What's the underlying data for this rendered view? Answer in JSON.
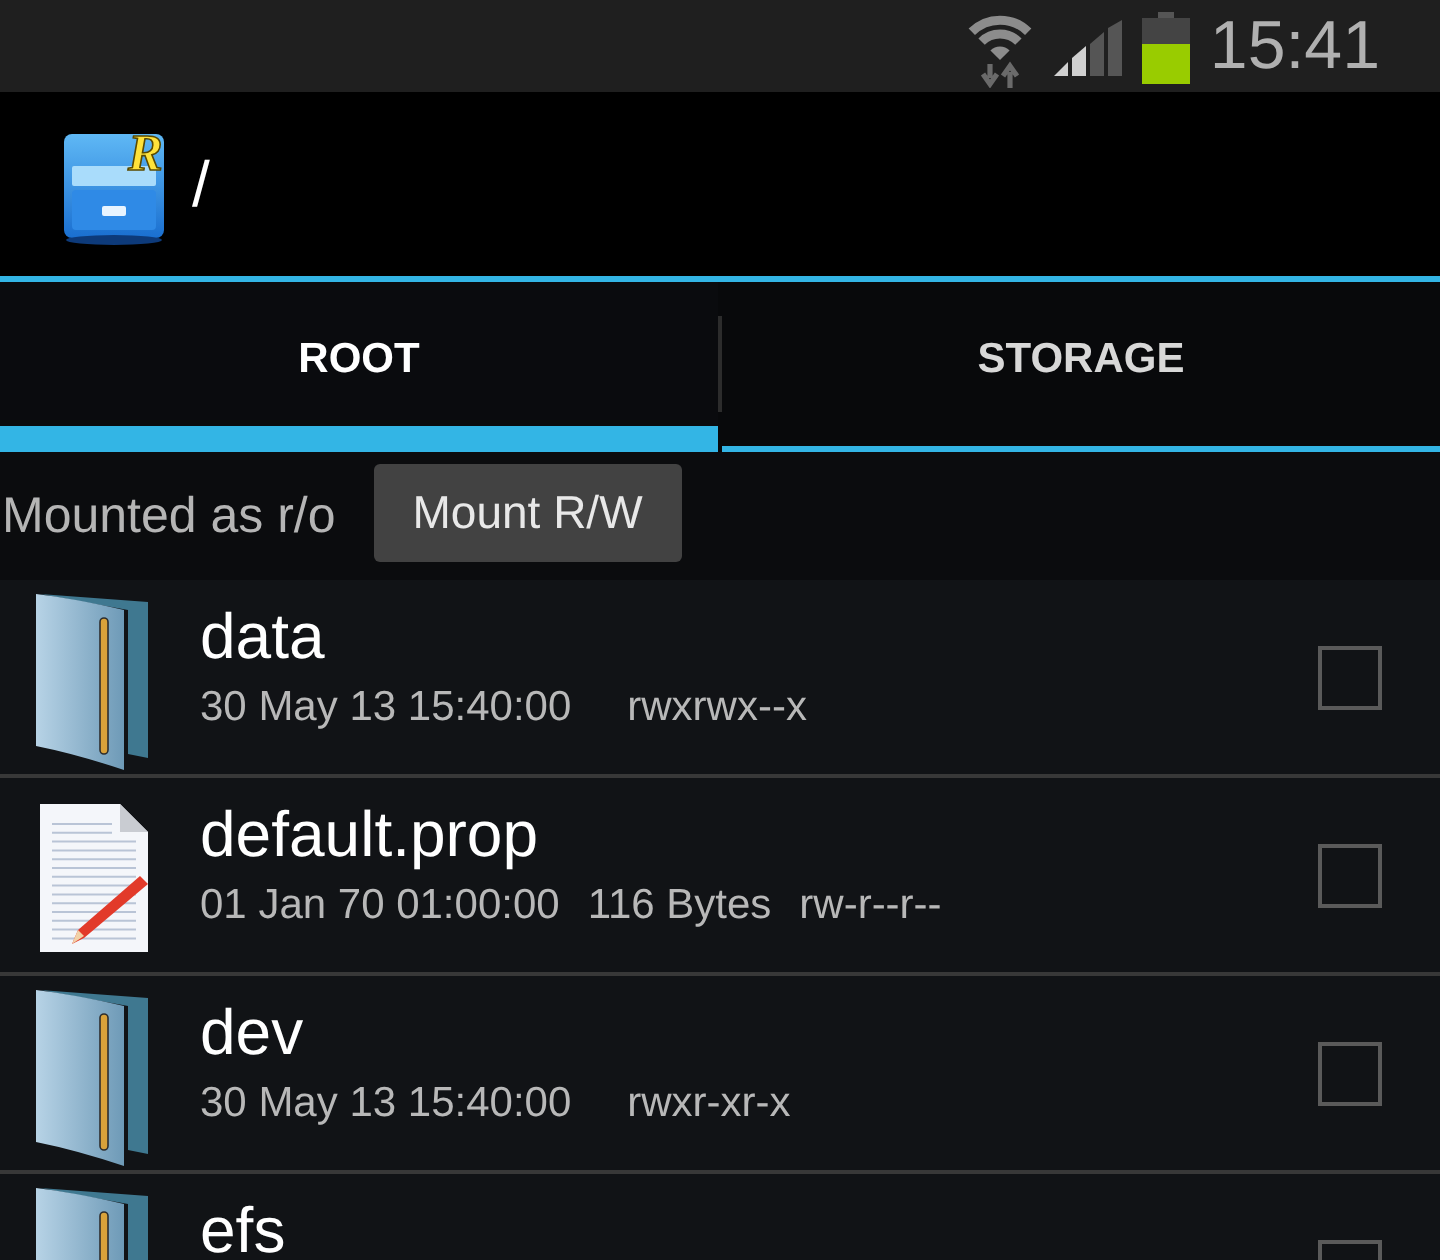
{
  "status_bar": {
    "time": "15:41"
  },
  "action_bar": {
    "logo_letter": "R",
    "path": "/"
  },
  "tabs": [
    {
      "label": "ROOT",
      "selected": true
    },
    {
      "label": "STORAGE",
      "selected": false
    }
  ],
  "mount": {
    "status": "Mounted as r/o",
    "button": "Mount R/W"
  },
  "files": [
    {
      "kind": "folder",
      "name": "data",
      "date": "30 May 13 15:40:00",
      "permissions": "rwxrwx--x",
      "checked": false
    },
    {
      "kind": "file",
      "name": "default.prop",
      "date": "01 Jan 70 01:00:00",
      "size": "116 Bytes",
      "permissions": "rw-r--r--",
      "checked": false
    },
    {
      "kind": "folder",
      "name": "dev",
      "date": "30 May 13 15:40:00",
      "permissions": "rwxr-xr-x",
      "checked": false
    },
    {
      "kind": "folder",
      "name": "efs",
      "checked": false
    }
  ]
}
